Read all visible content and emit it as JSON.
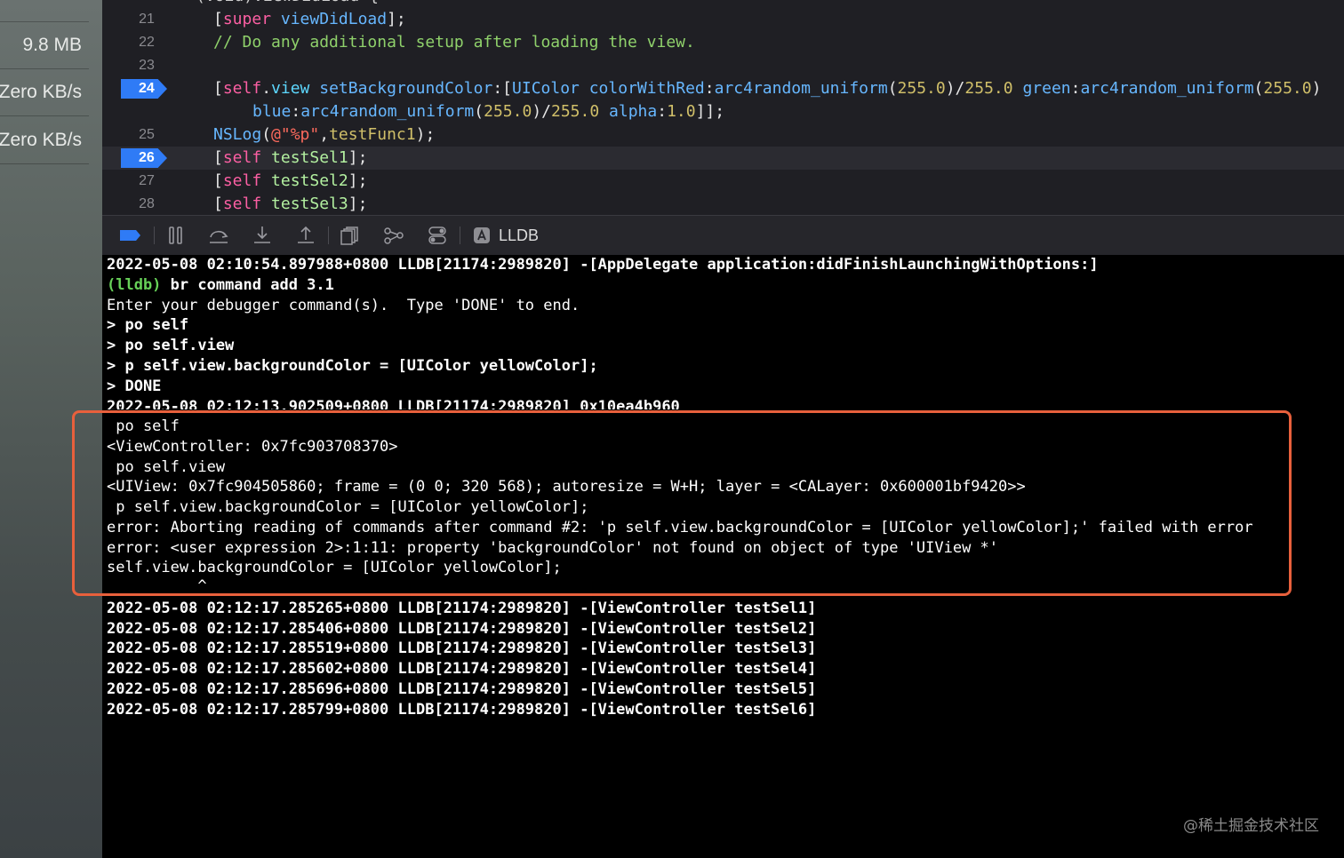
{
  "sidebar": {
    "items": [
      {
        "label": "9.8 MB"
      },
      {
        "label": "Zero KB/s"
      },
      {
        "label": "Zero KB/s"
      }
    ]
  },
  "editor": {
    "partial_top_line": "(void)viewDidLoad {",
    "lines": [
      {
        "number": "21",
        "breakpoint": false
      },
      {
        "number": "22",
        "breakpoint": false
      },
      {
        "number": "23",
        "breakpoint": false
      },
      {
        "number": "24",
        "breakpoint": true
      },
      {
        "number": "",
        "breakpoint": false
      },
      {
        "number": "25",
        "breakpoint": false
      },
      {
        "number": "26",
        "breakpoint": true
      },
      {
        "number": "27",
        "breakpoint": false
      },
      {
        "number": "28",
        "breakpoint": false
      }
    ],
    "tokens": {
      "l21_a": "[",
      "l21_super": "super",
      "l21_sel": "viewDidLoad",
      "l21_b": "];",
      "l22_comment": "// Do any additional setup after loading the view.",
      "l24_a": "[",
      "l24_self": "self",
      "l24_dot": ".",
      "l24_view": "view",
      "l24_sp": " ",
      "l24_sel": "setBackgroundColor",
      "l24_colon": ":[",
      "l24_cls": "UIColor",
      "l24_sp2": " ",
      "l24_sel2": "colorWithRed",
      "l24_c2": ":",
      "l24_fn1": "arc4random_uniform",
      "l24_p1": "(",
      "l24_n1": "255.0",
      "l24_p2": ")/",
      "l24_n2": "255.0",
      "l24_sp3": " ",
      "l24_green": "green",
      "l24_c3": ":",
      "l24_fn2": "arc4random_uniform",
      "l24_p3": "(",
      "l24_n3": "255.0",
      "l24_p4": ")",
      "l24b_blue": "blue",
      "l24b_c": ":",
      "l24b_fn": "arc4random_uniform",
      "l24b_p1": "(",
      "l24b_n1": "255.0",
      "l24b_p2": ")/",
      "l24b_n2": "255.0",
      "l24b_sp": " ",
      "l24b_alpha": "alpha",
      "l24b_c2": ":",
      "l24b_n3": "1.0",
      "l24b_end": "]];",
      "l25_fn": "NSLog",
      "l25_p": "(",
      "l25_str": "@\"%p\"",
      "l25_comma": ",",
      "l25_arg": "testFunc1",
      "l25_end": ");",
      "l26_a": "[",
      "l26_self": "self",
      "l26_sel": " testSel1",
      "l26_b": "];",
      "l27_a": "[",
      "l27_self": "self",
      "l27_sel": " testSel2",
      "l27_b": "];",
      "l28_a": "[",
      "l28_self": "self",
      "l28_sel": " testSel3",
      "l28_b": "];"
    }
  },
  "toolbar": {
    "icons": [
      "breakpoints-toggle-icon",
      "pause-icon",
      "step-over-icon",
      "step-into-icon",
      "step-out-icon",
      "view-hierarchy-icon",
      "memory-graph-icon",
      "environment-overrides-icon",
      "lldb-icon"
    ],
    "lldb_label": "LLDB",
    "accent_color": "#2f7bf6"
  },
  "console": {
    "lines": [
      {
        "text": "2022-05-08 02:10:54.897988+0800 LLDB[21174:2989820] -[AppDelegate application:didFinishLaunchingWithOptions:]",
        "bold": true
      },
      {
        "prompt": "(lldb)",
        "text": " br command add 3.1",
        "bold": true
      },
      {
        "text": "Enter your debugger command(s).  Type 'DONE' to end.",
        "bold": false
      },
      {
        "text": "> po self",
        "bold": true
      },
      {
        "text": "> po self.view",
        "bold": true
      },
      {
        "text": "> p self.view.backgroundColor = [UIColor yellowColor];",
        "bold": true
      },
      {
        "text": "> DONE",
        "bold": true
      },
      {
        "text": "2022-05-08 02:12:13.902509+0800 LLDB[21174:2989820] 0x10ea4b960",
        "bold": true,
        "clipped": true
      },
      {
        "text": " po self",
        "bold": false
      },
      {
        "text": "<ViewController: 0x7fc903708370>",
        "bold": false
      },
      {
        "text": " po self.view",
        "bold": false
      },
      {
        "text": "<UIView: 0x7fc904505860; frame = (0 0; 320 568); autoresize = W+H; layer = <CALayer: 0x600001bf9420>>",
        "bold": false
      },
      {
        "text": " p self.view.backgroundColor = [UIColor yellowColor];",
        "bold": false
      },
      {
        "text": "error: Aborting reading of commands after command #2: 'p self.view.backgroundColor = [UIColor yellowColor];' failed with error",
        "bold": false
      },
      {
        "text": "error: <user expression 2>:1:11: property 'backgroundColor' not found on object of type 'UIView *'",
        "bold": false
      },
      {
        "text": "self.view.backgroundColor = [UIColor yellowColor];",
        "bold": false
      },
      {
        "text": "          ^",
        "bold": false
      },
      {
        "text": "2022-05-08 02:12:17.285265+0800 LLDB[21174:2989820] -[ViewController testSel1]",
        "bold": true
      },
      {
        "text": "2022-05-08 02:12:17.285406+0800 LLDB[21174:2989820] -[ViewController testSel2]",
        "bold": true
      },
      {
        "text": "2022-05-08 02:12:17.285519+0800 LLDB[21174:2989820] -[ViewController testSel3]",
        "bold": true
      },
      {
        "text": "2022-05-08 02:12:17.285602+0800 LLDB[21174:2989820] -[ViewController testSel4]",
        "bold": true
      },
      {
        "text": "2022-05-08 02:12:17.285696+0800 LLDB[21174:2989820] -[ViewController testSel5]",
        "bold": true
      },
      {
        "text": "2022-05-08 02:12:17.285799+0800 LLDB[21174:2989820] -[ViewController testSel6]",
        "bold": true
      }
    ],
    "annotation_color": "#e8603c"
  },
  "watermark": "@稀土掘金技术社区"
}
